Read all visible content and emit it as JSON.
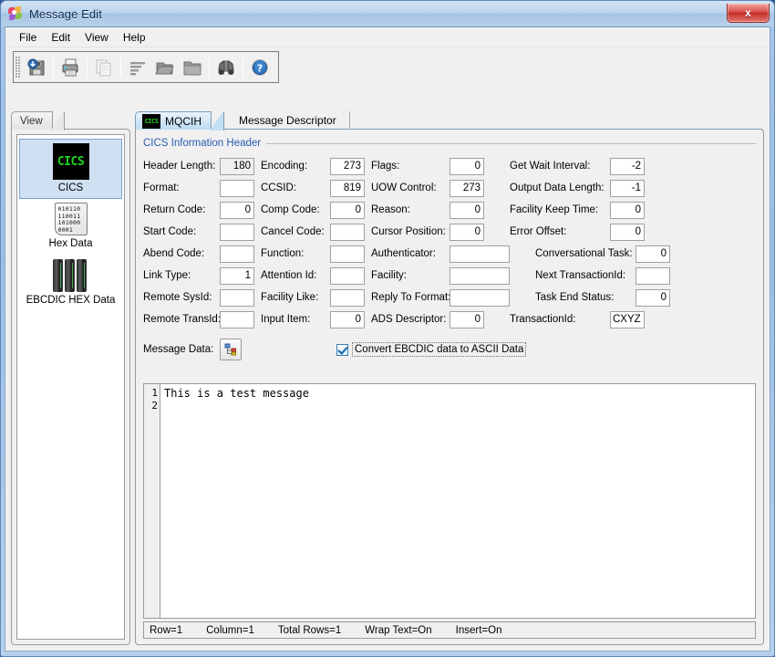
{
  "window": {
    "title": "Message Edit",
    "app_icon": "pinwheel-icon",
    "close_label": "x"
  },
  "menubar": {
    "items": [
      {
        "label": "File"
      },
      {
        "label": "Edit"
      },
      {
        "label": "View"
      },
      {
        "label": "Help"
      }
    ]
  },
  "toolbar": {
    "buttons": [
      {
        "name": "save-button",
        "icon": "floppy-save-icon",
        "enabled": true
      },
      {
        "name": "print-button",
        "icon": "printer-icon",
        "enabled": true
      },
      {
        "name": "copy-button",
        "icon": "copy-pages-icon",
        "enabled": false
      },
      {
        "name": "format-button",
        "icon": "align-lines-icon",
        "enabled": true
      },
      {
        "name": "open-folder-button",
        "icon": "folder-open-icon",
        "enabled": true
      },
      {
        "name": "folder-button",
        "icon": "folder-icon",
        "enabled": true
      },
      {
        "name": "find-button",
        "icon": "binoculars-icon",
        "enabled": true
      },
      {
        "name": "help-button",
        "icon": "help-question-icon",
        "enabled": true
      }
    ]
  },
  "view_panel": {
    "tab_label": "View",
    "items": [
      {
        "label": "CICS",
        "icon": "cics-icon",
        "selected": true
      },
      {
        "label": "Hex Data",
        "icon": "hex-data-icon",
        "selected": false
      },
      {
        "label": "EBCDIC HEX Data",
        "icon": "ebcdic-hex-data-icon",
        "selected": false
      }
    ]
  },
  "main_panel": {
    "tabs": [
      {
        "label": "MQCIH",
        "icon": "cics-icon",
        "active": true
      },
      {
        "label": "Message Descriptor",
        "icon": "",
        "active": false
      }
    ],
    "group_legend": "CICS Information Header",
    "rows": [
      {
        "c1": {
          "label": "Header Length:",
          "value": "180",
          "disabled": true
        },
        "c2": {
          "label": "Encoding:",
          "value": "273",
          "disabled": false
        },
        "c3": {
          "label": "Flags:",
          "value": "0",
          "disabled": false
        },
        "c4": {
          "label": "Get Wait Interval:",
          "value": "-2",
          "disabled": false
        }
      },
      {
        "c1": {
          "label": "Format:",
          "value": "",
          "disabled": false
        },
        "c2": {
          "label": "CCSID:",
          "value": "819",
          "disabled": false
        },
        "c3": {
          "label": "UOW Control:",
          "value": "273",
          "disabled": false
        },
        "c4": {
          "label": "Output Data Length:",
          "value": "-1",
          "disabled": false
        }
      },
      {
        "c1": {
          "label": "Return Code:",
          "value": "0",
          "disabled": false
        },
        "c2": {
          "label": "Comp Code:",
          "value": "0",
          "disabled": false
        },
        "c3": {
          "label": "Reason:",
          "value": "0",
          "disabled": false
        },
        "c4": {
          "label": "Facility Keep Time:",
          "value": "0",
          "disabled": false
        }
      },
      {
        "c1": {
          "label": "Start Code:",
          "value": "",
          "disabled": false
        },
        "c2": {
          "label": "Cancel Code:",
          "value": "",
          "disabled": false
        },
        "c3": {
          "label": "Cursor Position:",
          "value": "0",
          "disabled": false
        },
        "c4": {
          "label": "Error Offset:",
          "value": "0",
          "disabled": false
        }
      },
      {
        "c1": {
          "label": "Abend Code:",
          "value": "",
          "disabled": false
        },
        "c2": {
          "label": "Function:",
          "value": "",
          "disabled": false
        },
        "c3": {
          "label": "Authenticator:",
          "value": "",
          "disabled": false,
          "wide": true
        },
        "c4": {
          "label": "Conversational Task:",
          "value": "0",
          "disabled": false
        }
      },
      {
        "c1": {
          "label": "Link Type:",
          "value": "1",
          "disabled": false
        },
        "c2": {
          "label": "Attention Id:",
          "value": "",
          "disabled": false
        },
        "c3": {
          "label": "Facility:",
          "value": "",
          "disabled": false,
          "wide": true
        },
        "c4": {
          "label": "Next TransactionId:",
          "value": "",
          "disabled": false
        }
      },
      {
        "c1": {
          "label": "Remote SysId:",
          "value": "",
          "disabled": false
        },
        "c2": {
          "label": "Facility Like:",
          "value": "",
          "disabled": false
        },
        "c3": {
          "label": "Reply To Format:",
          "value": "",
          "disabled": false,
          "wide": true
        },
        "c4": {
          "label": "Task End Status:",
          "value": "0",
          "disabled": false
        }
      },
      {
        "c1": {
          "label": "Remote TransId:",
          "value": "",
          "disabled": false
        },
        "c2": {
          "label": "Input Item:",
          "value": "0",
          "disabled": false
        },
        "c3": {
          "label": "ADS Descriptor:",
          "value": "0",
          "disabled": false
        },
        "c4": {
          "label": "TransactionId:",
          "value": "CXYZ",
          "disabled": false,
          "align": "left"
        }
      }
    ],
    "message_data": {
      "label": "Message Data:",
      "button_icon": "tree-structure-icon",
      "convert_checkbox_label": "Convert EBCDIC data to ASCII Data",
      "convert_checked": true
    },
    "editor": {
      "line_numbers": "1\n2",
      "content": "This is a test message"
    },
    "statusbar": {
      "row": "Row=1",
      "column": "Column=1",
      "total_rows": "Total Rows=1",
      "wrap_text": "Wrap Text=On",
      "insert": "Insert=On"
    }
  },
  "colors": {
    "title_accent": "#a6c4e6",
    "group_legend": "#2a5db0",
    "selection": "#cfe0f3",
    "close_button": "#c22f2a",
    "cics_green": "#1fd41f"
  }
}
